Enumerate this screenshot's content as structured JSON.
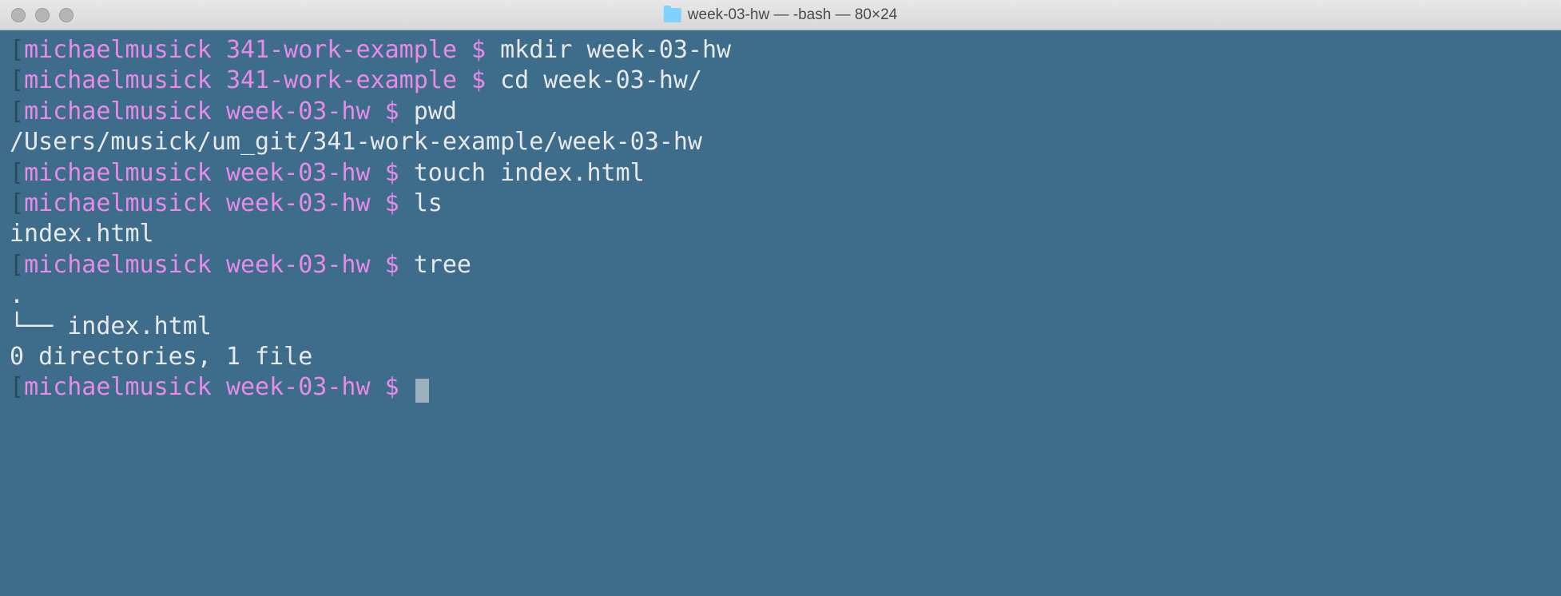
{
  "titlebar": {
    "title": "week-03-hw — -bash — 80×24"
  },
  "terminal": {
    "lines": [
      {
        "type": "prompt",
        "user": "michaelmusick",
        "dir": "341-work-example",
        "sym": "$",
        "cmd": "mkdir week-03-hw"
      },
      {
        "type": "prompt",
        "user": "michaelmusick",
        "dir": "341-work-example",
        "sym": "$",
        "cmd": "cd week-03-hw/"
      },
      {
        "type": "prompt",
        "user": "michaelmusick",
        "dir": "week-03-hw",
        "sym": "$",
        "cmd": "pwd"
      },
      {
        "type": "output",
        "text": "/Users/musick/um_git/341-work-example/week-03-hw"
      },
      {
        "type": "prompt",
        "user": "michaelmusick",
        "dir": "week-03-hw",
        "sym": "$",
        "cmd": "touch index.html"
      },
      {
        "type": "prompt",
        "user": "michaelmusick",
        "dir": "week-03-hw",
        "sym": "$",
        "cmd": "ls"
      },
      {
        "type": "output",
        "text": "index.html"
      },
      {
        "type": "prompt",
        "user": "michaelmusick",
        "dir": "week-03-hw",
        "sym": "$",
        "cmd": "tree"
      },
      {
        "type": "output",
        "text": "."
      },
      {
        "type": "output",
        "text": "└── index.html"
      },
      {
        "type": "output",
        "text": ""
      },
      {
        "type": "output",
        "text": "0 directories, 1 file"
      },
      {
        "type": "prompt",
        "user": "michaelmusick",
        "dir": "week-03-hw",
        "sym": "$",
        "cmd": "",
        "cursor": true
      }
    ]
  }
}
